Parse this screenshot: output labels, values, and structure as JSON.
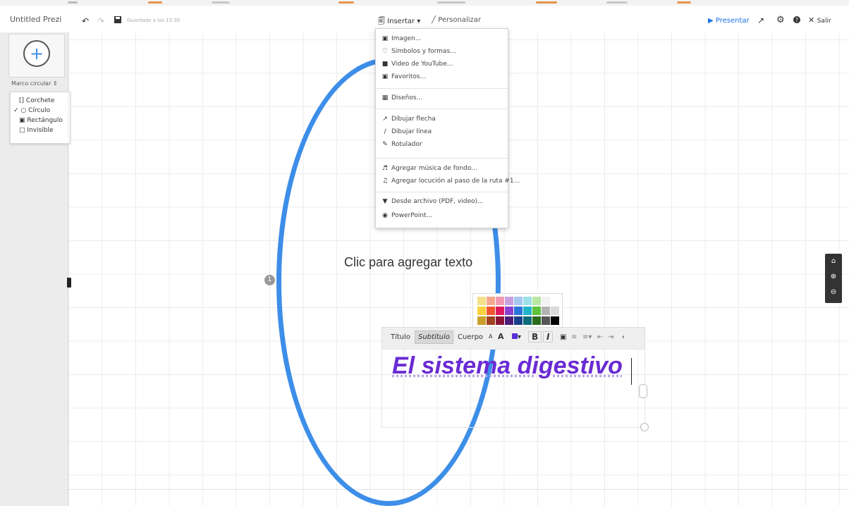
{
  "app": {
    "title": "Untitled Prezi",
    "saved_text": "Guardado a las 15:30"
  },
  "toolbar": {
    "insert_label": "Insertar",
    "customize_label": "Personalizar",
    "present_label": "Presentar",
    "exit_label": "Salir"
  },
  "sidebar": {
    "frame_select_label": "Marco circular"
  },
  "frame_menu": [
    {
      "label": "Corchete",
      "icon": "bracket-icon",
      "checked": false
    },
    {
      "label": "Círculo",
      "icon": "circle-icon",
      "checked": true
    },
    {
      "label": "Rectángulo",
      "icon": "rectangle-icon",
      "checked": false
    },
    {
      "label": "Invisible",
      "icon": "invisible-icon",
      "checked": false
    }
  ],
  "insert_menu": [
    {
      "label": "Imagen...",
      "icon": "image-icon"
    },
    {
      "label": "Símbolos y formas...",
      "icon": "symbols-icon"
    },
    {
      "label": "Video de YouTube...",
      "icon": "youtube-icon"
    },
    {
      "label": "Favoritos...",
      "icon": "favorites-icon"
    },
    {
      "label": "Diseños...",
      "icon": "layouts-icon"
    },
    {
      "label": "Dibujar flecha",
      "icon": "arrow-icon"
    },
    {
      "label": "Dibujar línea",
      "icon": "line-icon"
    },
    {
      "label": "Rotulador",
      "icon": "marker-icon"
    },
    {
      "label": "Agregar música de fondo...",
      "icon": "music-icon"
    },
    {
      "label": "Agregar locución al paso de la ruta #1...",
      "icon": "voiceover-icon"
    },
    {
      "label": "Desde archivo (PDF, video)...",
      "icon": "file-icon"
    },
    {
      "label": "PowerPoint...",
      "icon": "powerpoint-icon"
    }
  ],
  "canvas": {
    "placeholder_text": "Clic para agregar texto",
    "step_number": "1",
    "main_text": "El  sistema digestivo"
  },
  "text_toolbar": {
    "title": "Título",
    "subtitle": "Subtítulo",
    "body": "Cuerpo",
    "bold": "B",
    "italic": "I"
  },
  "colors": {
    "frame": "#3d8ee8",
    "text": "#6a2bd4",
    "accent": "#1a73e8"
  }
}
